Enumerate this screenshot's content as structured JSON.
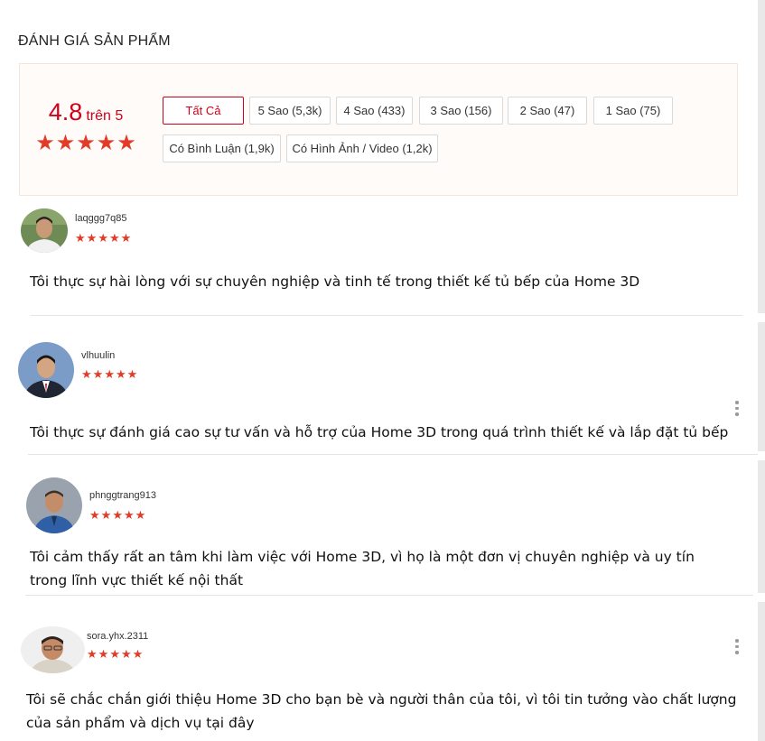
{
  "section_title": "ĐÁNH GIÁ SẢN PHẨM",
  "summary": {
    "score": "4.8",
    "score_suffix": "trên 5",
    "rating_stars": 5
  },
  "filters": [
    {
      "label": "Tất Cả",
      "active": true
    },
    {
      "label": "5 Sao (5,3k)",
      "active": false
    },
    {
      "label": "4 Sao (433)",
      "active": false
    },
    {
      "label": "3 Sao (156)",
      "active": false
    },
    {
      "label": "2 Sao (47)",
      "active": false
    },
    {
      "label": "1 Sao (75)",
      "active": false
    },
    {
      "label": "Có Bình Luận (1,9k)",
      "active": false
    },
    {
      "label": "Có Hình Ảnh / Video (1,2k)",
      "active": false
    }
  ],
  "reviews": [
    {
      "username": "laqggg7q85",
      "rating": 5,
      "comment": "Tôi thực sự hài lòng với sự chuyên nghiệp và tinh tế trong thiết kế tủ bếp của Home 3D",
      "has_more_menu": false
    },
    {
      "username": "vlhuulin",
      "rating": 5,
      "comment": "Tôi thực sự đánh giá cao sự tư vấn và hỗ trợ của Home 3D trong quá trình thiết kế và lắp đặt tủ bếp",
      "has_more_menu": true
    },
    {
      "username": "phnggtrang913",
      "rating": 5,
      "comment": "Tôi cảm thấy rất an tâm khi làm việc với Home 3D, vì họ là một đơn vị chuyên nghiệp và uy tín trong lĩnh vực thiết kế nội thất",
      "has_more_menu": false
    },
    {
      "username": "sora.yhx.2311",
      "rating": 5,
      "comment": "Tôi sẽ chắc chắn giới thiệu Home 3D cho bạn bè và người thân của tôi, vì tôi tin tưởng vào chất lượng của sản phẩm và dịch vụ tại đây",
      "has_more_menu": true
    }
  ],
  "icons": {
    "star": "star-icon",
    "more": "more-vertical-icon",
    "avatar": "avatar"
  },
  "colors": {
    "accent": "#d0011b",
    "star": "#e23b27",
    "summary_bg": "#fffbf8"
  }
}
